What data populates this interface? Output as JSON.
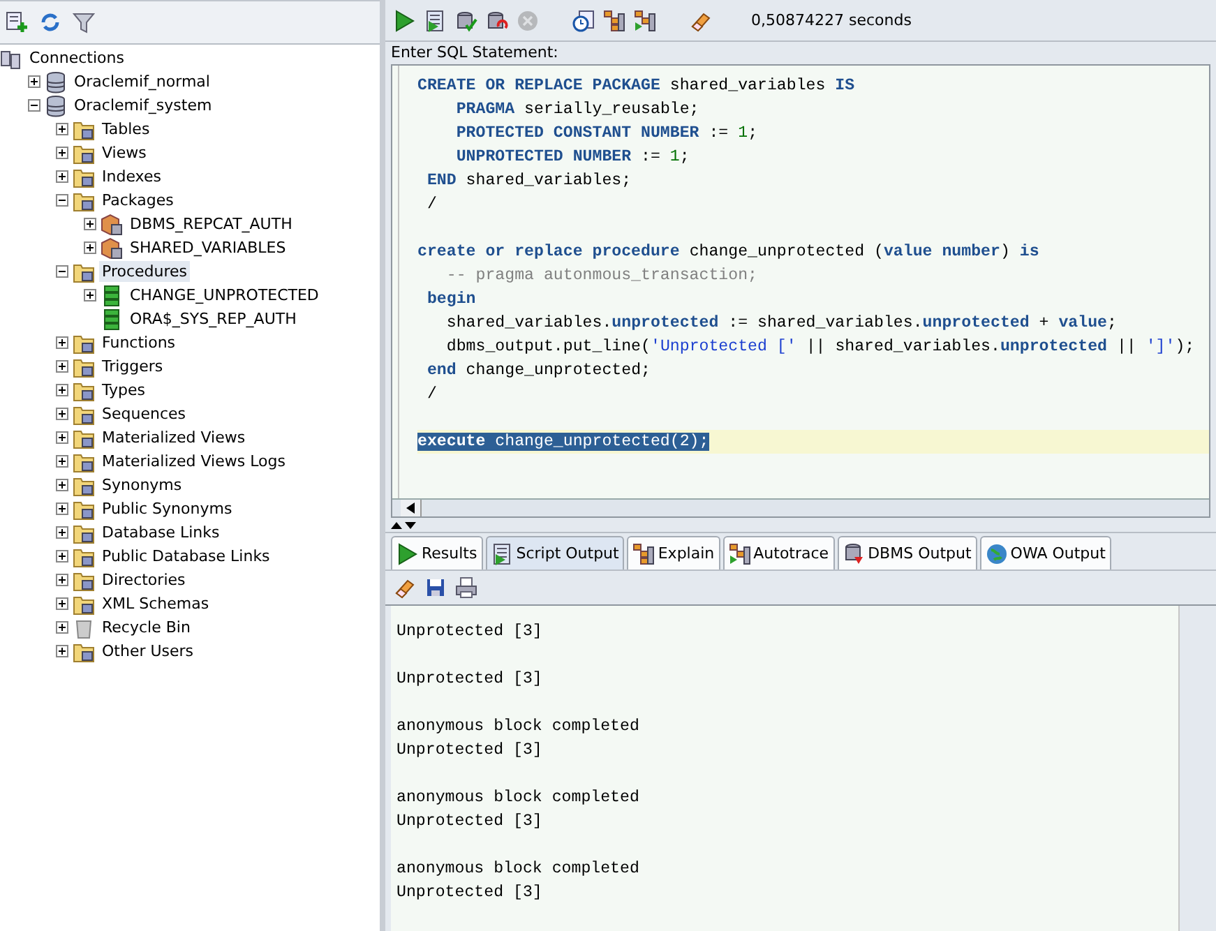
{
  "navigator": {
    "toolbar": [
      {
        "kind": "add"
      },
      {
        "kind": "refresh"
      },
      {
        "kind": "filter"
      }
    ],
    "tree": [
      {
        "label": "Connections",
        "kind": "connections",
        "selected": false,
        "children": [
          {
            "label": "Oraclemif_normal",
            "kind": "database",
            "expanded": false,
            "selected": false
          },
          {
            "label": "Oraclemif_system",
            "kind": "database",
            "expanded": true,
            "selected": false,
            "children": [
              {
                "label": "Tables",
                "kind": "folder",
                "expanded": false,
                "selected": false
              },
              {
                "label": "Views",
                "kind": "folder",
                "expanded": false,
                "selected": false
              },
              {
                "label": "Indexes",
                "kind": "folder",
                "expanded": false,
                "selected": false
              },
              {
                "label": "Packages",
                "kind": "folder",
                "expanded": true,
                "selected": false,
                "children": [
                  {
                    "label": "DBMS_REPCAT_AUTH",
                    "kind": "package",
                    "expanded": false,
                    "selected": false
                  },
                  {
                    "label": "SHARED_VARIABLES",
                    "kind": "package",
                    "expanded": false,
                    "selected": false
                  }
                ]
              },
              {
                "label": "Procedures",
                "kind": "folder",
                "expanded": true,
                "selected": true,
                "children": [
                  {
                    "label": "CHANGE_UNPROTECTED",
                    "kind": "procedure",
                    "expanded": false,
                    "selected": false
                  },
                  {
                    "label": "ORA$_SYS_REP_AUTH",
                    "kind": "procedure",
                    "selected": false
                  }
                ]
              },
              {
                "label": "Functions",
                "kind": "folder",
                "expanded": false,
                "selected": false
              },
              {
                "label": "Triggers",
                "kind": "folder",
                "expanded": false,
                "selected": false
              },
              {
                "label": "Types",
                "kind": "folder",
                "expanded": false,
                "selected": false
              },
              {
                "label": "Sequences",
                "kind": "folder",
                "expanded": false,
                "selected": false
              },
              {
                "label": "Materialized Views",
                "kind": "folder",
                "expanded": false,
                "selected": false
              },
              {
                "label": "Materialized Views Logs",
                "kind": "folder",
                "expanded": false,
                "selected": false
              },
              {
                "label": "Synonyms",
                "kind": "folder",
                "expanded": false,
                "selected": false
              },
              {
                "label": "Public Synonyms",
                "kind": "folder",
                "expanded": false,
                "selected": false
              },
              {
                "label": "Database Links",
                "kind": "folder",
                "expanded": false,
                "selected": false
              },
              {
                "label": "Public Database Links",
                "kind": "folder",
                "expanded": false,
                "selected": false
              },
              {
                "label": "Directories",
                "kind": "folder",
                "expanded": false,
                "selected": false
              },
              {
                "label": "XML Schemas",
                "kind": "folder",
                "expanded": false,
                "selected": false
              },
              {
                "label": "Recycle Bin",
                "kind": "trash",
                "expanded": false,
                "selected": false
              },
              {
                "label": "Other Users",
                "kind": "folder",
                "expanded": false,
                "selected": false
              }
            ]
          }
        ]
      }
    ]
  },
  "worksheet": {
    "toolbar": [
      {
        "kind": "run",
        "disabled": false
      },
      {
        "kind": "script",
        "disabled": false
      },
      {
        "kind": "commit",
        "disabled": false
      },
      {
        "kind": "rollback",
        "disabled": false
      },
      {
        "kind": "cancel",
        "disabled": true
      },
      {
        "kind": "gap"
      },
      {
        "kind": "history",
        "disabled": false
      },
      {
        "kind": "explain",
        "disabled": false
      },
      {
        "kind": "autotrace",
        "disabled": false
      },
      {
        "kind": "gap"
      },
      {
        "kind": "clear",
        "disabled": false
      }
    ],
    "elapsed": "0,50874227 seconds",
    "editor_label": "Enter SQL Statement:",
    "lines": [
      {
        "kind": "code",
        "selected": false,
        "tokens": [
          {
            "kind": "kw",
            "text": "CREATE OR REPLACE PACKAGE"
          },
          {
            "kind": "plain",
            "text": " shared_variables "
          },
          {
            "kind": "kw",
            "text": "IS"
          }
        ]
      },
      {
        "kind": "code",
        "selected": false,
        "tokens": [
          {
            "kind": "kw",
            "text": "    PRAGMA"
          },
          {
            "kind": "plain",
            "text": " serially_reusable;"
          }
        ]
      },
      {
        "kind": "code",
        "selected": false,
        "tokens": [
          {
            "kind": "kw",
            "text": "    PROTECTED CONSTANT NUMBER"
          },
          {
            "kind": "plain",
            "text": " := "
          },
          {
            "kind": "num",
            "text": "1"
          },
          {
            "kind": "plain",
            "text": ";"
          }
        ]
      },
      {
        "kind": "code",
        "selected": false,
        "tokens": [
          {
            "kind": "kw",
            "text": "    UNPROTECTED NUMBER"
          },
          {
            "kind": "plain",
            "text": " := "
          },
          {
            "kind": "num",
            "text": "1"
          },
          {
            "kind": "plain",
            "text": ";"
          }
        ]
      },
      {
        "kind": "code",
        "selected": false,
        "tokens": [
          {
            "kind": "kw",
            "text": " END"
          },
          {
            "kind": "plain",
            "text": " shared_variables;"
          }
        ]
      },
      {
        "kind": "code",
        "selected": false,
        "tokens": [
          {
            "kind": "plain",
            "text": " /"
          }
        ]
      },
      {
        "kind": "blank",
        "selected": false
      },
      {
        "kind": "code",
        "selected": false,
        "tokens": [
          {
            "kind": "kw",
            "text": "create or replace procedure"
          },
          {
            "kind": "plain",
            "text": " change_unprotected ("
          },
          {
            "kind": "kw",
            "text": "value number"
          },
          {
            "kind": "plain",
            "text": ") "
          },
          {
            "kind": "kw",
            "text": "is"
          }
        ]
      },
      {
        "kind": "code",
        "selected": false,
        "tokens": [
          {
            "kind": "comment",
            "text": "   -- pragma autonmous_transaction;"
          }
        ]
      },
      {
        "kind": "code",
        "selected": false,
        "tokens": [
          {
            "kind": "kw",
            "text": " begin"
          }
        ]
      },
      {
        "kind": "code",
        "selected": false,
        "tokens": [
          {
            "kind": "plain",
            "text": "   shared_variables."
          },
          {
            "kind": "kw",
            "text": "unprotected"
          },
          {
            "kind": "plain",
            "text": " := shared_variables."
          },
          {
            "kind": "kw",
            "text": "unprotected"
          },
          {
            "kind": "plain",
            "text": " + "
          },
          {
            "kind": "kw",
            "text": "value"
          },
          {
            "kind": "plain",
            "text": ";"
          }
        ]
      },
      {
        "kind": "code",
        "selected": false,
        "tokens": [
          {
            "kind": "plain",
            "text": "   dbms_output.put_line("
          },
          {
            "kind": "str",
            "text": "'Unprotected ['"
          },
          {
            "kind": "plain",
            "text": " || shared_variables."
          },
          {
            "kind": "kw",
            "text": "unprotected"
          },
          {
            "kind": "plain",
            "text": " || "
          },
          {
            "kind": "str",
            "text": "']'"
          },
          {
            "kind": "plain",
            "text": ");"
          }
        ]
      },
      {
        "kind": "code",
        "selected": false,
        "tokens": [
          {
            "kind": "kw",
            "text": " end"
          },
          {
            "kind": "plain",
            "text": " change_unprotected;"
          }
        ]
      },
      {
        "kind": "code",
        "selected": false,
        "tokens": [
          {
            "kind": "plain",
            "text": " /"
          }
        ]
      },
      {
        "kind": "blank",
        "selected": false
      },
      {
        "kind": "code",
        "selected": true,
        "tokens": [
          {
            "kind": "kw",
            "text": "execute"
          },
          {
            "kind": "plain",
            "text": " change_unprotected(2);"
          }
        ]
      }
    ],
    "tabs": [
      {
        "label": "Results",
        "kind": "run",
        "selected": false
      },
      {
        "label": "Script Output",
        "kind": "script",
        "selected": true
      },
      {
        "label": "Explain",
        "kind": "explain",
        "selected": false
      },
      {
        "label": "Autotrace",
        "kind": "autotrace",
        "selected": false
      },
      {
        "label": "DBMS Output",
        "kind": "dbms",
        "selected": false
      },
      {
        "label": "OWA Output",
        "kind": "globe",
        "selected": false
      }
    ],
    "output_toolbar": [
      {
        "kind": "clear"
      },
      {
        "kind": "save"
      },
      {
        "kind": "print"
      }
    ],
    "output": [
      [
        "Unprotected [3]"
      ],
      [
        "Unprotected [3]"
      ],
      [
        "anonymous block completed",
        "Unprotected [3]"
      ],
      [
        "anonymous block completed",
        "Unprotected [3]"
      ],
      [
        "anonymous block completed",
        "Unprotected [3]"
      ]
    ]
  }
}
